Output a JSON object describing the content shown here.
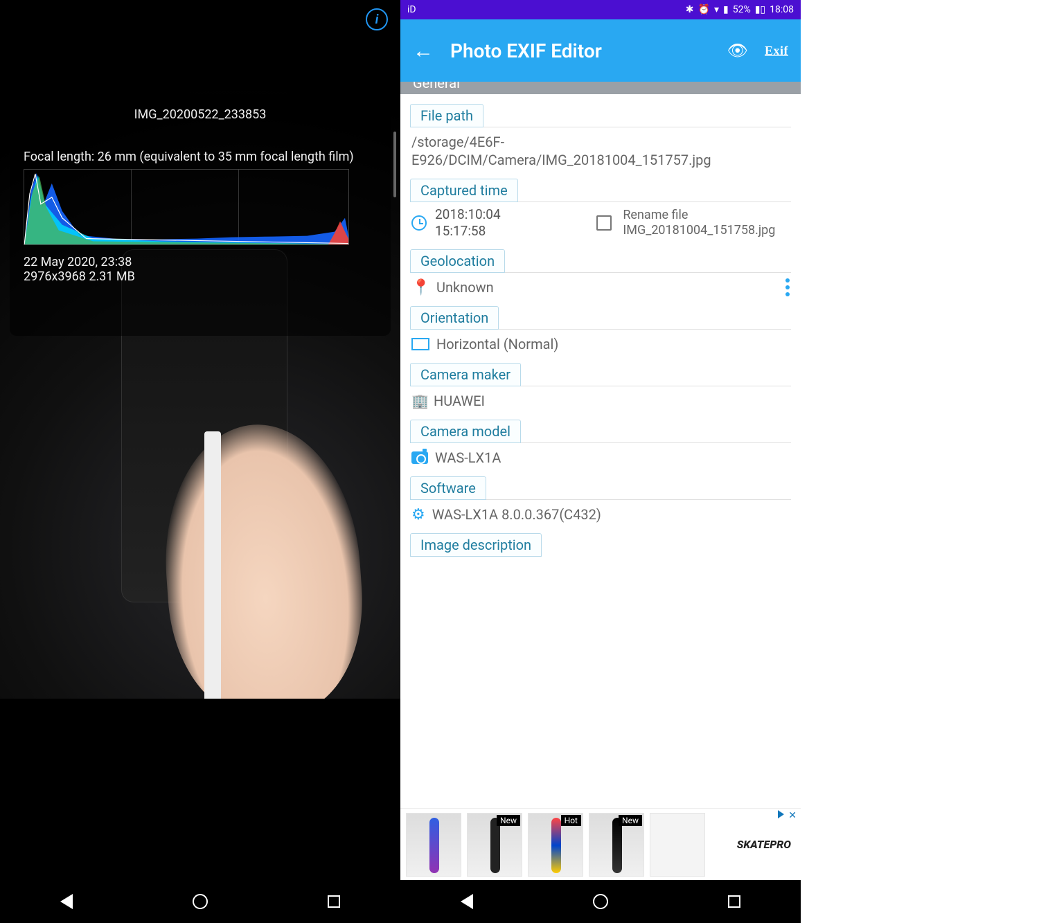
{
  "left": {
    "filename": "IMG_20200522_233853",
    "focal_text": "Focal length: 26 mm (equivalent to 35 mm focal length film)",
    "date_text": "22 May 2020, 23:38",
    "dimensions_text": "2976x3968  2.31 MB"
  },
  "right": {
    "status": {
      "carrier": "iD",
      "battery_pct": "52%",
      "time": "18:08"
    },
    "app_title": "Photo EXIF Editor",
    "general_label": "General",
    "file_path": {
      "label": "File path",
      "value": "/storage/4E6F-E926/DCIM/Camera/IMG_20181004_151757.jpg"
    },
    "captured": {
      "label": "Captured time",
      "date": "2018:10:04",
      "time": "15:17:58",
      "rename_label": "Rename file",
      "rename_value": "IMG_20181004_151758.jpg"
    },
    "geolocation": {
      "label": "Geolocation",
      "value": "Unknown"
    },
    "orientation": {
      "label": "Orientation",
      "value": "Horizontal (Normal)"
    },
    "maker": {
      "label": "Camera maker",
      "value": "HUAWEI"
    },
    "model": {
      "label": "Camera model",
      "value": "WAS-LX1A"
    },
    "software": {
      "label": "Software",
      "value": "WAS-LX1A 8.0.0.367(C432)"
    },
    "image_desc": {
      "label": "Image description"
    },
    "ad": {
      "tag_new": "New",
      "tag_hot": "Hot",
      "brand": "SKATEPRO"
    }
  }
}
